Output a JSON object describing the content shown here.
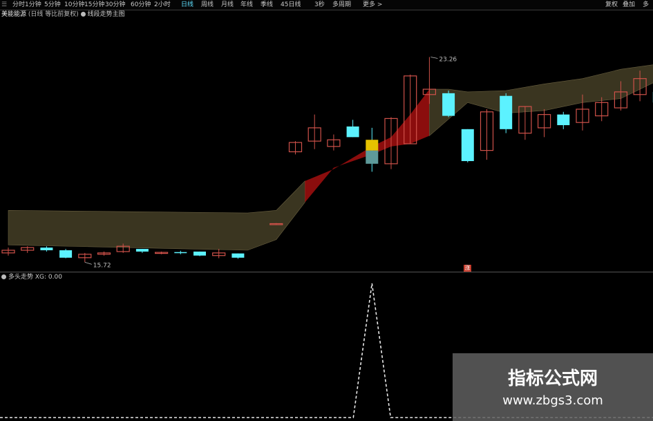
{
  "toolbar": {
    "tabs": [
      {
        "label": "分时",
        "active": false
      },
      {
        "label": "1分钟",
        "active": false
      },
      {
        "label": "5分钟",
        "active": false
      },
      {
        "label": "10分钟",
        "active": false
      },
      {
        "label": "15分钟",
        "active": false
      },
      {
        "label": "30分钟",
        "active": false
      },
      {
        "label": "60分钟",
        "active": false
      },
      {
        "label": "2小时",
        "active": false
      },
      {
        "label": "日线",
        "active": true
      },
      {
        "label": "周线",
        "active": false
      },
      {
        "label": "月线",
        "active": false
      },
      {
        "label": "年线",
        "active": false
      },
      {
        "label": "季线",
        "active": false
      },
      {
        "label": "45日线",
        "active": false
      },
      {
        "label": "3秒",
        "active": false
      },
      {
        "label": "多周期",
        "active": false
      },
      {
        "label": "更多 >",
        "active": false
      }
    ],
    "right": {
      "restore": "复权",
      "overlay": "叠加",
      "multi": "多"
    }
  },
  "title": {
    "stock": "美能能源",
    "mode": "(日线 等比前复权)",
    "indicator": "线段走势主图"
  },
  "marker_label": "涨",
  "sub_indicator": {
    "name": "多头走势",
    "value_label": "XG: 0.00"
  },
  "watermark": {
    "title": "指标公式网",
    "url": "www.zbgs3.com"
  },
  "colors": {
    "up": "#d0524a",
    "down": "#5cf2ff",
    "band": "#3a3520",
    "band_edge": "#6a6040",
    "red_band": "#8b0d0d",
    "signal": "#e6c200",
    "background": "#000000"
  },
  "chart_data": {
    "type": "candlestick",
    "annotations": {
      "high_label": "23.26",
      "low_label": "15.72"
    },
    "candles": [
      {
        "o": 15.9,
        "c": 16.0,
        "h": 16.1,
        "l": 15.8
      },
      {
        "o": 16.0,
        "c": 16.1,
        "h": 16.15,
        "l": 15.9
      },
      {
        "o": 16.1,
        "c": 16.0,
        "h": 16.15,
        "l": 15.95
      },
      {
        "o": 16.0,
        "c": 15.72,
        "h": 16.05,
        "l": 15.7
      },
      {
        "o": 15.72,
        "c": 15.85,
        "h": 15.9,
        "l": 15.55
      },
      {
        "o": 15.85,
        "c": 15.9,
        "h": 15.95,
        "l": 15.8
      },
      {
        "o": 15.95,
        "c": 16.15,
        "h": 16.25,
        "l": 15.9
      },
      {
        "o": 16.05,
        "c": 15.95,
        "h": 16.05,
        "l": 15.9
      },
      {
        "o": 15.9,
        "c": 15.92,
        "h": 15.95,
        "l": 15.85
      },
      {
        "o": 15.93,
        "c": 15.92,
        "h": 15.98,
        "l": 15.85
      },
      {
        "o": 15.95,
        "c": 15.8,
        "h": 15.95,
        "l": 15.78
      },
      {
        "o": 15.8,
        "c": 15.9,
        "h": 16.05,
        "l": 15.7
      },
      {
        "o": 15.88,
        "c": 15.72,
        "h": 15.88,
        "l": 15.68
      },
      null,
      {
        "o": 17.0,
        "c": 17.0,
        "h": 17.02,
        "l": 16.98
      },
      {
        "o": 19.7,
        "c": 20.05,
        "h": 20.1,
        "l": 19.6
      },
      {
        "o": 20.1,
        "c": 20.6,
        "h": 21.1,
        "l": 19.8
      },
      {
        "o": 19.9,
        "c": 20.15,
        "h": 20.35,
        "l": 19.75
      },
      {
        "o": 20.65,
        "c": 20.25,
        "h": 20.9,
        "l": 20.25
      },
      {
        "o": 20.15,
        "c": 19.25,
        "h": 20.6,
        "l": 18.95
      },
      {
        "o": 19.25,
        "c": 20.95,
        "h": 21.0,
        "l": 19.05
      },
      {
        "o": 20.0,
        "c": 22.55,
        "h": 22.6,
        "l": 20.0
      },
      {
        "o": 21.85,
        "c": 22.05,
        "h": 23.26,
        "l": 21.5
      },
      {
        "o": 21.9,
        "c": 21.05,
        "h": 22.0,
        "l": 21.0
      },
      {
        "o": 20.55,
        "c": 19.35,
        "h": 20.55,
        "l": 19.3
      },
      {
        "o": 19.75,
        "c": 21.2,
        "h": 21.3,
        "l": 19.4
      },
      {
        "o": 21.8,
        "c": 20.55,
        "h": 21.9,
        "l": 20.4
      },
      {
        "o": 20.4,
        "c": 21.4,
        "h": 21.4,
        "l": 20.15
      },
      {
        "o": 20.6,
        "c": 21.1,
        "h": 21.3,
        "l": 20.25
      },
      {
        "o": 21.1,
        "c": 20.7,
        "h": 21.2,
        "l": 20.55
      },
      {
        "o": 20.8,
        "c": 21.3,
        "h": 21.85,
        "l": 20.5
      },
      {
        "o": 21.05,
        "c": 21.55,
        "h": 21.75,
        "l": 20.85
      },
      {
        "o": 21.35,
        "c": 21.95,
        "h": 22.35,
        "l": 21.25
      },
      {
        "o": 21.85,
        "c": 22.45,
        "h": 22.75,
        "l": 21.6
      },
      {
        "o": 21.95,
        "c": 21.55,
        "h": 22.0,
        "l": 21.35
      }
    ],
    "signal_candle_index": 19,
    "sub_series": [
      0,
      0,
      0,
      0,
      0,
      0,
      0,
      0,
      0,
      0,
      0,
      0,
      0,
      0,
      0,
      0,
      0,
      0,
      0,
      1,
      0,
      0,
      0,
      0,
      0,
      0,
      0,
      0,
      0,
      0,
      0,
      0,
      0,
      0,
      0
    ]
  }
}
